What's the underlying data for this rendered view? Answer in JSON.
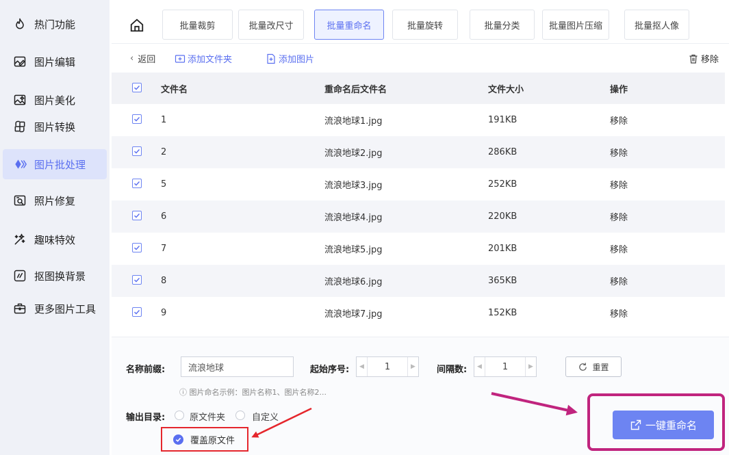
{
  "sidebar": {
    "items": [
      {
        "label": "热门功能",
        "icon": "hot-icon"
      },
      {
        "label": "图片编辑",
        "icon": "edit-image-icon"
      },
      {
        "label": "图片美化",
        "icon": "beautify-icon"
      },
      {
        "label": "图片转换",
        "icon": "convert-icon"
      },
      {
        "label": "图片批处理",
        "icon": "batch-icon",
        "active": true
      },
      {
        "label": "照片修复",
        "icon": "repair-icon"
      },
      {
        "label": "趣味特效",
        "icon": "effects-icon"
      },
      {
        "label": "抠图换背景",
        "icon": "cutout-icon"
      },
      {
        "label": "更多图片工具",
        "icon": "toolbox-icon"
      }
    ]
  },
  "tabs": [
    {
      "label": "批量裁剪"
    },
    {
      "label": "批量改尺寸"
    },
    {
      "label": "批量重命名",
      "active": true
    },
    {
      "label": "批量旋转"
    },
    {
      "label": "批量分类"
    },
    {
      "label": "批量图片压缩"
    },
    {
      "label": "批量抠人像"
    }
  ],
  "toolbar": {
    "back": "返回",
    "add_folder": "添加文件夹",
    "add_image": "添加图片",
    "remove": "移除"
  },
  "table": {
    "headers": {
      "name": "文件名",
      "new_name": "重命名后文件名",
      "size": "文件大小",
      "op": "操作"
    },
    "rows": [
      {
        "name": "1",
        "new_name": "流浪地球1.jpg",
        "size": "191KB",
        "op": "移除"
      },
      {
        "name": "2",
        "new_name": "流浪地球2.jpg",
        "size": "286KB",
        "op": "移除"
      },
      {
        "name": "5",
        "new_name": "流浪地球3.jpg",
        "size": "252KB",
        "op": "移除"
      },
      {
        "name": "6",
        "new_name": "流浪地球4.jpg",
        "size": "220KB",
        "op": "移除"
      },
      {
        "name": "7",
        "new_name": "流浪地球5.jpg",
        "size": "201KB",
        "op": "移除"
      },
      {
        "name": "8",
        "new_name": "流浪地球6.jpg",
        "size": "365KB",
        "op": "移除"
      },
      {
        "name": "9",
        "new_name": "流浪地球7.jpg",
        "size": "152KB",
        "op": "移除"
      }
    ]
  },
  "settings": {
    "prefix_label": "名称前缀:",
    "prefix_value": "流浪地球",
    "start_label": "起始序号:",
    "start_value": "1",
    "interval_label": "间隔数:",
    "interval_value": "1",
    "reset": "重置",
    "hint": "ⓘ 图片命名示例：图片名称1、图片名称2...",
    "output_label": "输出目录:",
    "opt_original": "原文件夹",
    "opt_custom": "自定义",
    "opt_overwrite": "覆盖原文件"
  },
  "primary_button": "一键重命名",
  "colors": {
    "accent": "#6d84f2",
    "highlight_box": "#c0247e",
    "annotation_red": "#e5262c"
  }
}
